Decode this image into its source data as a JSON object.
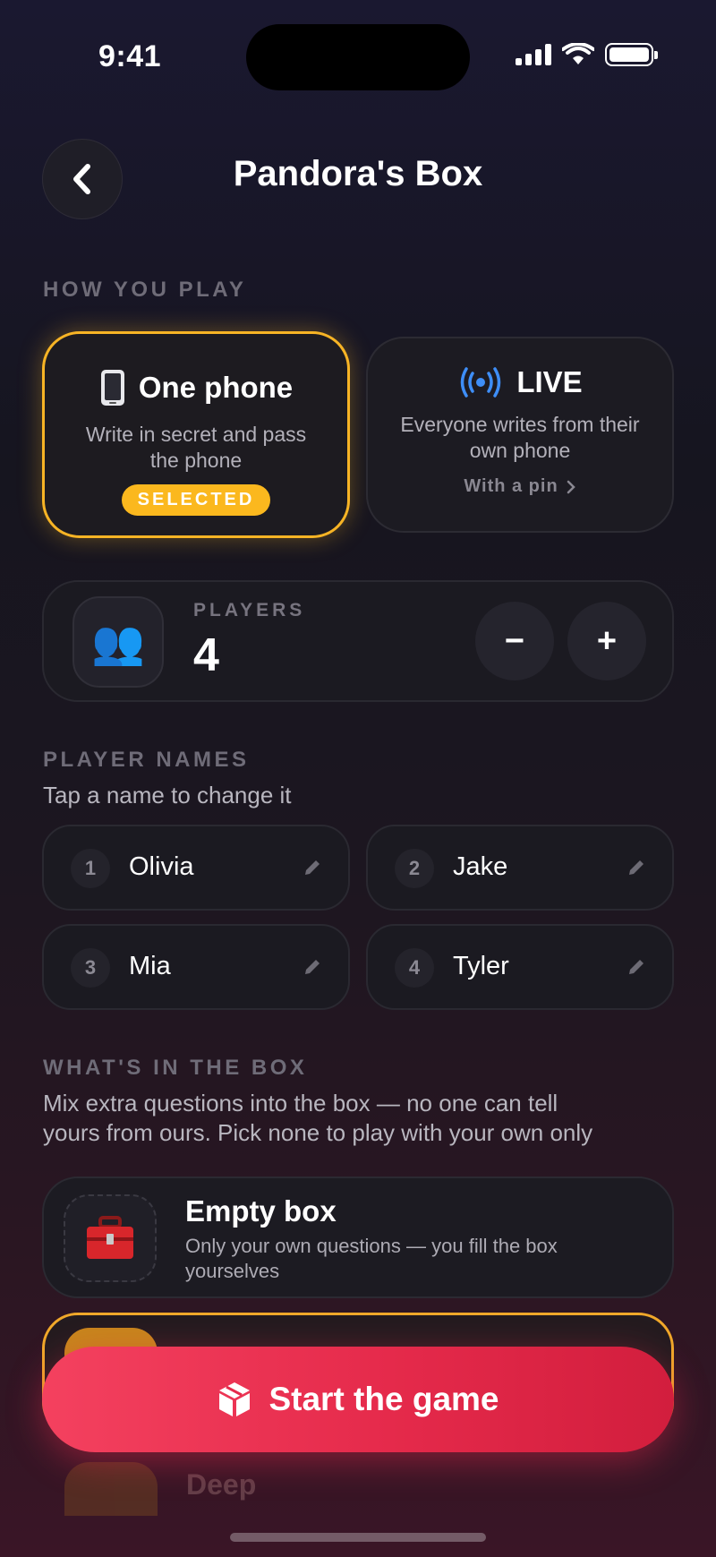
{
  "status_bar": {
    "time": "9:41"
  },
  "header": {
    "title": "Pandora's Box",
    "back_icon": "chevron-left-icon"
  },
  "how_you_play": {
    "label": "HOW YOU PLAY",
    "modes": [
      {
        "title": "One phone",
        "icon": "phone-icon",
        "description": "Write in secret and pass the phone",
        "badge": "SELECTED",
        "selected": true
      },
      {
        "title": "LIVE",
        "icon": "broadcast-icon",
        "description": "Everyone writes from their own phone",
        "link": "With a pin",
        "selected": false
      }
    ]
  },
  "players": {
    "label": "PLAYERS",
    "count": "4",
    "emoji": "👥",
    "minus": "−",
    "plus": "+"
  },
  "player_names": {
    "label": "PLAYER NAMES",
    "subtitle": "Tap a name to change it",
    "names": [
      {
        "num": "1",
        "name": "Olivia"
      },
      {
        "num": "2",
        "name": "Jake"
      },
      {
        "num": "3",
        "name": "Mia"
      },
      {
        "num": "4",
        "name": "Tyler"
      }
    ]
  },
  "box": {
    "label": "WHAT'S IN THE BOX",
    "subtitle_line1": "Mix extra questions into the box — no one can tell",
    "subtitle_line2": "yours from ours. Pick none to play with your own only",
    "options": [
      {
        "title": "Empty box",
        "emoji": "🧰",
        "description": "Only your own questions — you fill the box yourselves"
      }
    ],
    "partial_option": "Deep"
  },
  "cta": {
    "label": "Start the game",
    "icon": "cube-icon"
  },
  "colors": {
    "accent": "#fbb81e",
    "cta": "#e52a4b",
    "live_blue": "#3e8ef7"
  }
}
